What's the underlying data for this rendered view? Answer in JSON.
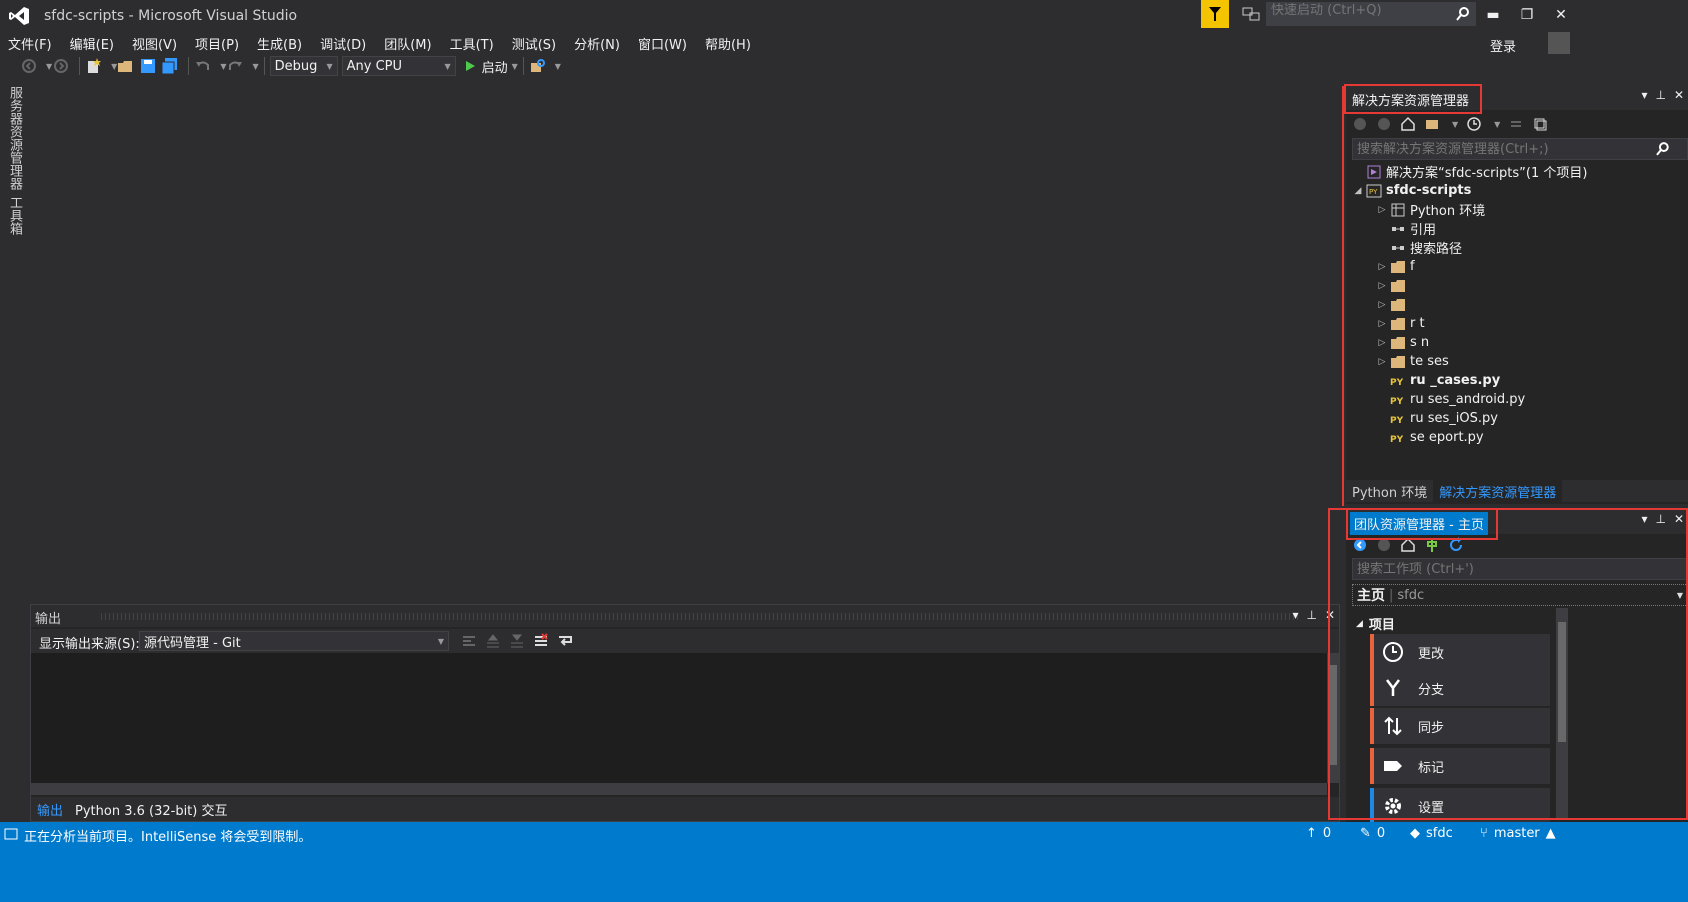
{
  "window": {
    "title": "sfdc-scripts - Microsoft Visual Studio",
    "quick_launch_placeholder": "快速启动 (Ctrl+Q)",
    "login_label": "登录",
    "minimize": "▬",
    "maximize": "❐",
    "close": "✕"
  },
  "menu": [
    "文件(F)",
    "编辑(E)",
    "视图(V)",
    "项目(P)",
    "生成(B)",
    "调试(D)",
    "团队(M)",
    "工具(T)",
    "测试(S)",
    "分析(N)",
    "窗口(W)",
    "帮助(H)"
  ],
  "toolbar": {
    "configuration": "Debug",
    "platform": "Any CPU",
    "start_label": "启动"
  },
  "left_strip": {
    "server_explorer": "服务器资源管理器",
    "toolbox": "工具箱"
  },
  "output": {
    "title": "输出",
    "source_label": "显示输出来源(S):",
    "source_value": "源代码管理 - Git",
    "tabs": [
      "输出",
      "Python 3.6 (32-bit) 交互"
    ]
  },
  "solution_explorer": {
    "title": "解决方案资源管理器",
    "search_placeholder": "搜索解决方案资源管理器(Ctrl+;)",
    "tree": [
      {
        "label": "解决方案“sfdc-scripts”(1 个项目)",
        "level": 0,
        "arrow": "",
        "icon": "solution-icon",
        "bold": false
      },
      {
        "label": "sfdc-scripts",
        "level": 0,
        "arrow": "◢",
        "icon": "python-project-icon",
        "bold": true
      },
      {
        "label": "Python 环境",
        "level": 1,
        "arrow": "▷",
        "icon": "python-env-icon",
        "bold": false
      },
      {
        "label": "引用",
        "level": 1,
        "arrow": "",
        "icon": "reference-icon",
        "bold": false
      },
      {
        "label": "搜索路径",
        "level": 1,
        "arrow": "",
        "icon": "reference-icon",
        "bold": false
      },
      {
        "label": "f",
        "level": 1,
        "arrow": "▷",
        "icon": "folder-icon",
        "bold": false
      },
      {
        "label": "",
        "level": 1,
        "arrow": "▷",
        "icon": "folder-icon",
        "bold": false
      },
      {
        "label": "",
        "level": 1,
        "arrow": "▷",
        "icon": "folder-icon",
        "bold": false
      },
      {
        "label": "r t",
        "level": 1,
        "arrow": "▷",
        "icon": "folder-icon",
        "bold": false
      },
      {
        "label": "s n",
        "level": 1,
        "arrow": "▷",
        "icon": "folder-icon",
        "bold": false
      },
      {
        "label": "te ses",
        "level": 1,
        "arrow": "▷",
        "icon": "folder-icon",
        "bold": false
      },
      {
        "label": "ru _cases.py",
        "level": 1,
        "arrow": "",
        "icon": "python-file-icon",
        "bold": true
      },
      {
        "label": "ru ses_android.py",
        "level": 1,
        "arrow": "",
        "icon": "python-file-icon",
        "bold": false
      },
      {
        "label": "ru ses_iOS.py",
        "level": 1,
        "arrow": "",
        "icon": "python-file-icon",
        "bold": false
      },
      {
        "label": "se eport.py",
        "level": 1,
        "arrow": "",
        "icon": "python-file-icon",
        "bold": false
      }
    ],
    "bottom_tabs": [
      "Python 环境",
      "解决方案资源管理器"
    ]
  },
  "team_explorer": {
    "title": "团队资源管理器 - 主页",
    "search_placeholder": "搜索工作项 (Ctrl+')",
    "page_title": "主页",
    "repo": "sfdc",
    "section": "项目",
    "tiles": [
      {
        "label": "更改",
        "icon": "clock-icon",
        "accent": "orange"
      },
      {
        "label": "分支",
        "icon": "branch-icon",
        "accent": "orange"
      },
      {
        "label": "同步",
        "icon": "sync-icon",
        "accent": "orange"
      },
      {
        "label": "标记",
        "icon": "tag-icon",
        "accent": "orange"
      },
      {
        "label": "设置",
        "icon": "gear-icon",
        "accent": "blue"
      }
    ]
  },
  "status": {
    "message": "正在分析当前项目。IntelliSense 将会受到限制。",
    "up_count": "0",
    "edit_count": "0",
    "repo": "sfdc",
    "branch": "master"
  },
  "colors": {
    "accent": "#007acc",
    "highlight": "#e53935",
    "tile_orange": "#e8643c",
    "tile_blue": "#1e88e5",
    "notification": "#f5c400"
  }
}
